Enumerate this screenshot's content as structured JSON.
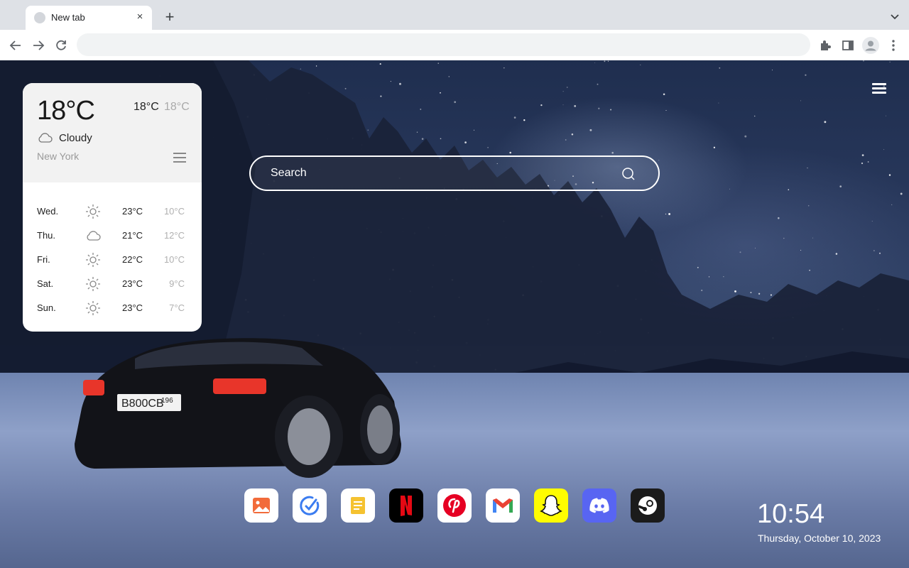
{
  "browser": {
    "tab_title": "New tab",
    "tab_close": "×",
    "new_tab": "+",
    "address_value": ""
  },
  "weather": {
    "current_temp": "18°C",
    "high": "18°C",
    "low": "18°C",
    "condition": "Cloudy",
    "condition_icon": "cloud-icon",
    "city": "New York",
    "forecast": [
      {
        "day": "Wed.",
        "icon": "sun-icon",
        "high": "23°C",
        "low": "10°C"
      },
      {
        "day": "Thu.",
        "icon": "cloud-icon",
        "high": "21°C",
        "low": "12°C"
      },
      {
        "day": "Fri.",
        "icon": "sun-icon",
        "high": "22°C",
        "low": "10°C"
      },
      {
        "day": "Sat.",
        "icon": "sun-icon",
        "high": "23°C",
        "low": "9°C"
      },
      {
        "day": "Sun.",
        "icon": "sun-icon",
        "high": "23°C",
        "low": "7°C"
      }
    ]
  },
  "search": {
    "placeholder": "Search"
  },
  "dock": {
    "apps": [
      {
        "name": "gallery",
        "color": "#e8572e"
      },
      {
        "name": "todo",
        "color": "#3b7cf0"
      },
      {
        "name": "notes",
        "color": "#f2b61c"
      },
      {
        "name": "netflix",
        "color": "#e50914"
      },
      {
        "name": "pinterest",
        "color": "#e60023"
      },
      {
        "name": "gmail",
        "color": "#ea4335"
      },
      {
        "name": "snapchat",
        "color": "#fffc00"
      },
      {
        "name": "discord",
        "color": "#5865f2"
      },
      {
        "name": "steam",
        "color": "#1b1b1b"
      }
    ]
  },
  "clock": {
    "time": "10:54",
    "date": "Thursday, October 10, 2023"
  }
}
